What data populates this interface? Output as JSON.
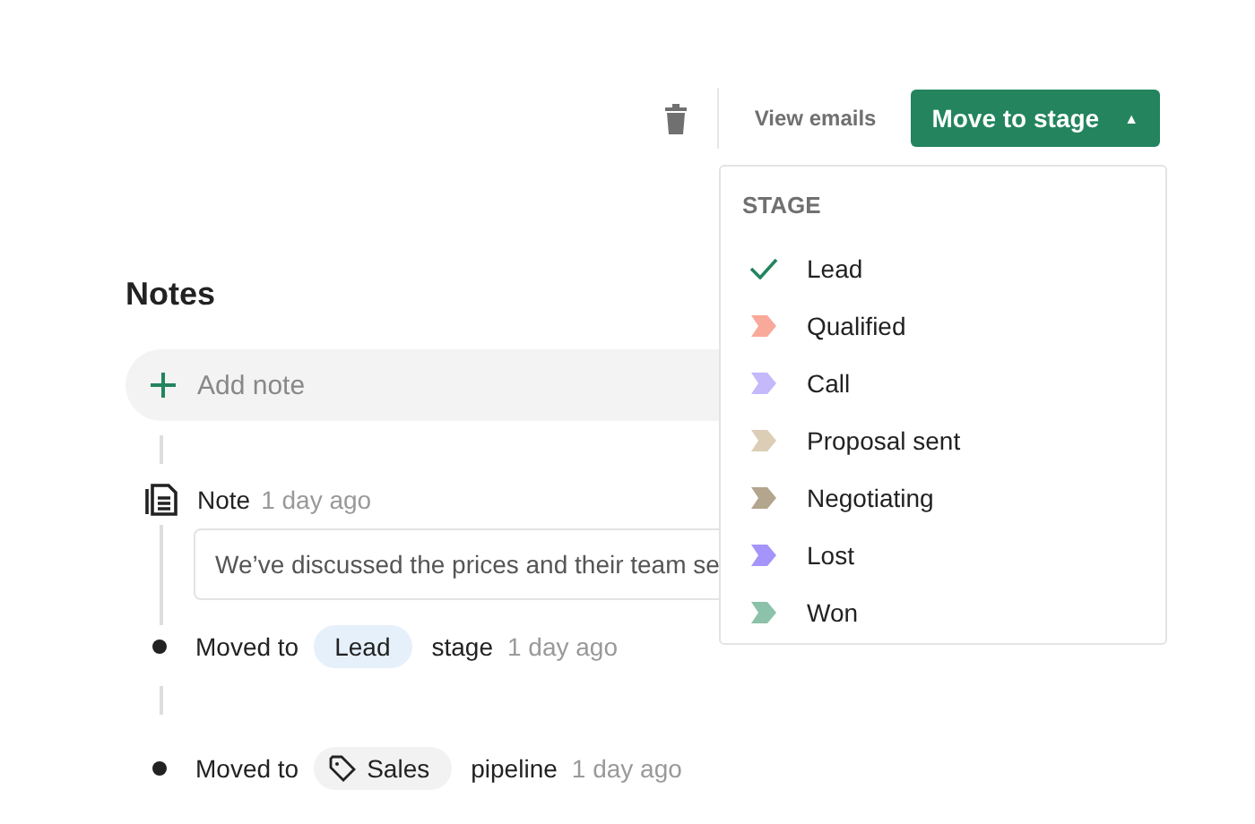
{
  "toolbar": {
    "view_emails": "View emails",
    "move_button": "Move to stage",
    "caret": "▲"
  },
  "dropdown": {
    "heading": "STAGE",
    "items": [
      {
        "label": "Lead",
        "selected": true
      },
      {
        "label": "Qualified",
        "selected": false,
        "color": "#f9a99a"
      },
      {
        "label": "Call",
        "selected": false,
        "color": "#c5b8fb"
      },
      {
        "label": "Proposal sent",
        "selected": false,
        "color": "#dccdb6"
      },
      {
        "label": "Negotiating",
        "selected": false,
        "color": "#b3a58e"
      },
      {
        "label": "Lost",
        "selected": false,
        "color": "#a594f9"
      },
      {
        "label": "Won",
        "selected": false,
        "color": "#8cc1aa"
      }
    ]
  },
  "notes": {
    "title": "Notes",
    "add_note": {
      "placeholder": "Add note"
    },
    "timeline": [
      {
        "kind": "note",
        "label": "Note",
        "time": "1 day ago",
        "body": "We’ve discussed the prices and their team se"
      },
      {
        "kind": "stage",
        "prefix": "Moved to",
        "tag": "Lead",
        "suffix": "stage",
        "time": "1 day ago"
      },
      {
        "kind": "pipeline",
        "prefix": "Moved to",
        "tag": "Sales",
        "suffix": "pipeline",
        "time": "1 day ago"
      }
    ]
  }
}
